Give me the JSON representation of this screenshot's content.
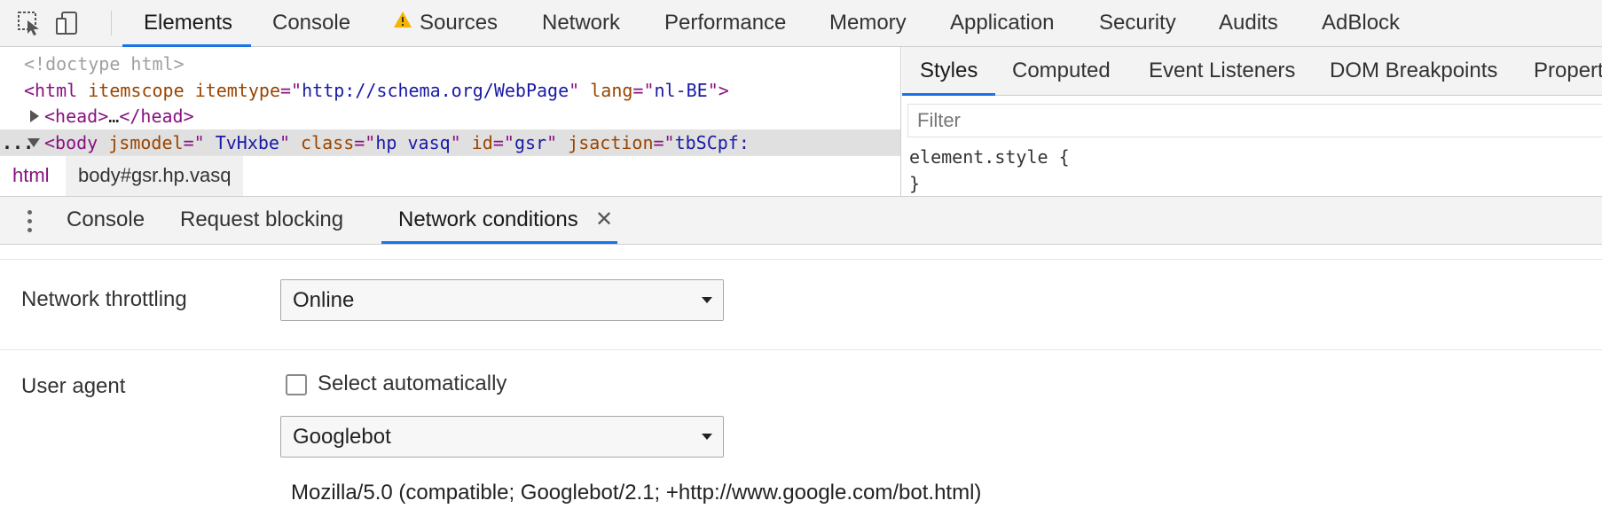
{
  "toolbar": {
    "icons": [
      "inspect-element-icon",
      "device-toolbar-icon",
      "warning-icon"
    ],
    "tabs": [
      {
        "label": "Elements",
        "active": true
      },
      {
        "label": "Console"
      },
      {
        "label": "Sources",
        "warning": true
      },
      {
        "label": "Network"
      },
      {
        "label": "Performance"
      },
      {
        "label": "Memory"
      },
      {
        "label": "Application"
      },
      {
        "label": "Security"
      },
      {
        "label": "Audits"
      },
      {
        "label": "AdBlock"
      }
    ]
  },
  "dom_tree": {
    "doctype": "<!doctype html>",
    "html_tag": "html",
    "html_attr1": "itemscope",
    "html_attr2": "itemtype",
    "html_attr2_val": "http://schema.org/WebPage",
    "html_attr3": "lang",
    "html_attr3_val": "nl-BE",
    "head_tag": "head",
    "head_ellipsis": "…",
    "body_tag": "body",
    "body_attr1": "jsmodel",
    "body_attr1_val": " TvHxbe",
    "body_attr2": "class",
    "body_attr2_val": "hp vasq",
    "body_attr3": "id",
    "body_attr3_val": "gsr",
    "body_attr4": "jsaction",
    "body_attr4_val": "tbSCpf:",
    "dots": "..."
  },
  "breadcrumb": {
    "items": [
      "html",
      "body#gsr.hp.vasq"
    ]
  },
  "styles": {
    "tabs": [
      {
        "label": "Styles",
        "active": true
      },
      {
        "label": "Computed"
      },
      {
        "label": "Event Listeners"
      },
      {
        "label": "DOM Breakpoints"
      },
      {
        "label": "Propert"
      }
    ],
    "filter_placeholder": "Filter",
    "rule_selector": "element.style {",
    "rule_close": "}"
  },
  "drawer": {
    "tabs": [
      {
        "label": "Console"
      },
      {
        "label": "Request blocking"
      },
      {
        "label": "Network conditions",
        "active": true,
        "closable": true
      }
    ],
    "close_glyph": "✕"
  },
  "network_conditions": {
    "throttling_label": "Network throttling",
    "throttling_value": "Online",
    "user_agent_label": "User agent",
    "select_automatically_label": "Select automatically",
    "select_automatically_checked": false,
    "user_agent_value": "Googlebot",
    "user_agent_string": "Mozilla/5.0 (compatible; Googlebot/2.1; +http://www.google.com/bot.html)"
  },
  "colors": {
    "accent": "#1a73e8",
    "tag": "#881280",
    "attribute": "#994500",
    "attribute_value": "#1a1aa6",
    "warning": "#f4b400"
  }
}
